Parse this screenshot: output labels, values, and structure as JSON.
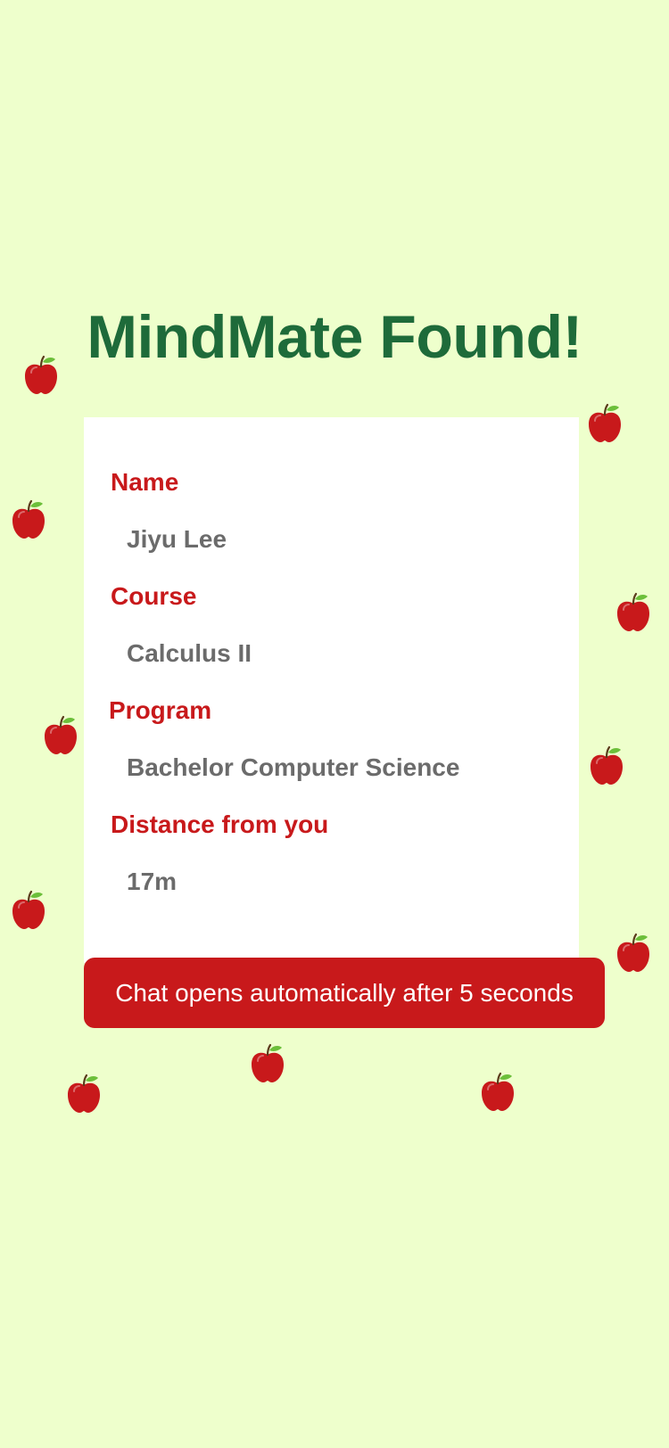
{
  "title": "MindMate Found!",
  "colors": {
    "background": "#eeffcc",
    "title": "#1e6b3a",
    "label": "#c8191b",
    "value": "#6b6b6b",
    "button": "#c8191b",
    "apple_red": "#c8191b",
    "apple_leaf": "#6cbf3a"
  },
  "profile": {
    "fields": [
      {
        "label": "Name",
        "value": "Jiyu Lee"
      },
      {
        "label": "Course",
        "value": "Calculus II"
      },
      {
        "label": "Program",
        "value": "Bachelor Computer Science"
      },
      {
        "label": "Distance from you",
        "value": "17m"
      }
    ]
  },
  "cta": {
    "label": "Chat opens automatically after 5 seconds"
  },
  "decoration": {
    "icon": "apple-icon"
  }
}
